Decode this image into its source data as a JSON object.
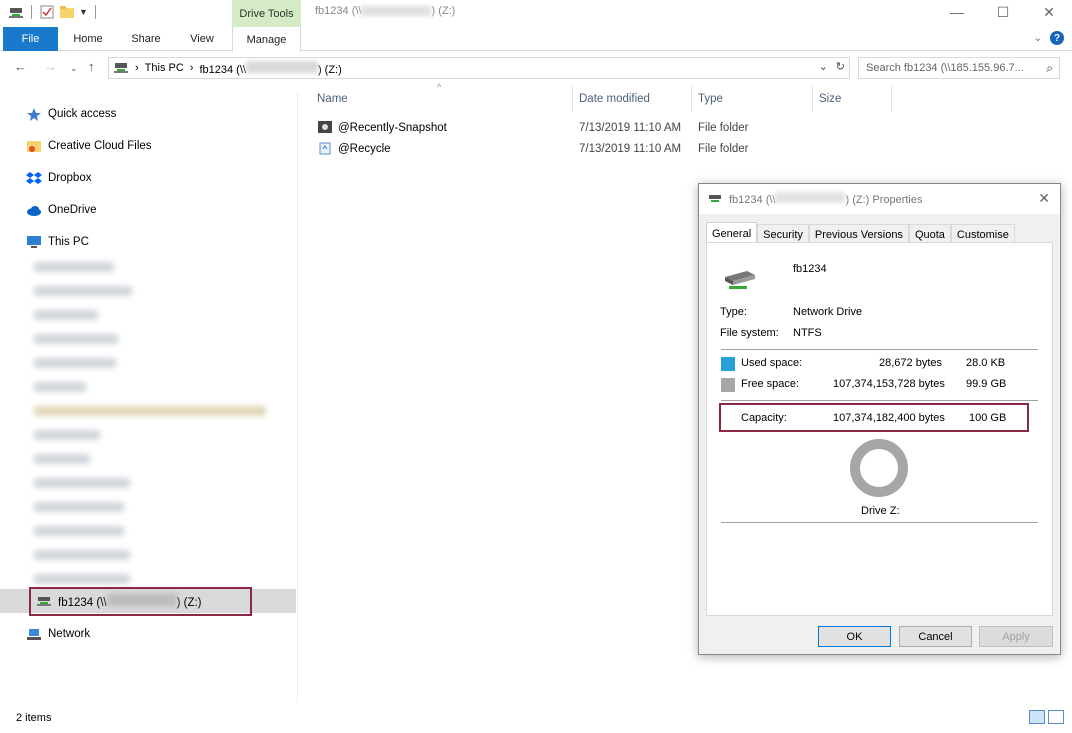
{
  "titlebar": {
    "context_tab": "Drive Tools",
    "title_prefix": "fb1234 (\\\\",
    "title_suffix": ") (Z:)",
    "minimize": "—",
    "maximize": "☐",
    "close": "✕"
  },
  "ribbon": {
    "tabs": [
      "File",
      "Home",
      "Share",
      "View",
      "Manage"
    ]
  },
  "address": {
    "crumbs": [
      "This PC",
      "fb1234 (\\\\",
      ") (Z:)"
    ],
    "search_placeholder": "Search fb1234 (\\\\185.155.96.7..."
  },
  "nav": {
    "quick_access": "Quick access",
    "creative_cloud": "Creative Cloud Files",
    "dropbox": "Dropbox",
    "onedrive": "OneDrive",
    "this_pc": "This PC",
    "drive_prefix": "fb1234 (\\\\",
    "drive_suffix": ") (Z:)",
    "network": "Network"
  },
  "columns": [
    "Name",
    "Date modified",
    "Type",
    "Size"
  ],
  "files": [
    {
      "name": "@Recently-Snapshot",
      "date": "7/13/2019 11:10 AM",
      "type": "File folder"
    },
    {
      "name": "@Recycle",
      "date": "7/13/2019 11:10 AM",
      "type": "File folder"
    }
  ],
  "status": {
    "items": "2 items"
  },
  "dialog": {
    "title_prefix": "fb1234 (\\\\",
    "title_suffix": ") (Z:) Properties",
    "tabs": [
      "General",
      "Security",
      "Previous Versions",
      "Quota",
      "Customise"
    ],
    "drive_name": "fb1234",
    "type_label": "Type:",
    "type_value": "Network Drive",
    "fs_label": "File system:",
    "fs_value": "NTFS",
    "used_label": "Used space:",
    "used_bytes": "28,672 bytes",
    "used_size": "28.0 KB",
    "free_label": "Free space:",
    "free_bytes": "107,374,153,728 bytes",
    "free_size": "99.9 GB",
    "cap_label": "Capacity:",
    "cap_bytes": "107,374,182,400 bytes",
    "cap_size": "100 GB",
    "drive_label": "Drive Z:",
    "ok": "OK",
    "cancel": "Cancel",
    "apply": "Apply",
    "used_color": "#26a0da",
    "free_color": "#a6a6a6"
  }
}
